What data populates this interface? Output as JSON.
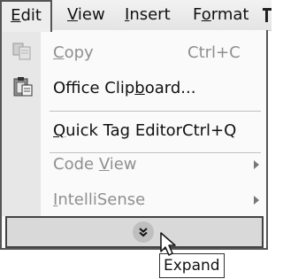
{
  "menubar": {
    "items": [
      {
        "label": "Edit",
        "key": "E",
        "rest": "dit"
      },
      {
        "label": "View",
        "key": "V",
        "rest": "iew"
      },
      {
        "label": "Insert",
        "key": "I",
        "rest": "nsert"
      },
      {
        "label": "Format",
        "pre": "F",
        "key": "o",
        "rest": "rmat"
      }
    ]
  },
  "menu": {
    "items": [
      {
        "pre": "",
        "key": "C",
        "rest": "opy",
        "shortcut": "Ctrl+C",
        "disabled": true,
        "icon": "copy-icon"
      },
      {
        "pre": "Office Clip",
        "key": "b",
        "rest": "oard...",
        "shortcut": "",
        "disabled": false,
        "icon": "clipboard-icon"
      },
      {
        "pre": "",
        "key": "Q",
        "rest": "uick Tag Editor",
        "shortcut": "Ctrl+Q",
        "disabled": false
      },
      {
        "pre": "Code ",
        "key": "V",
        "rest": "iew",
        "shortcut": "",
        "disabled": true,
        "submenu": true
      },
      {
        "pre": "",
        "key": "I",
        "rest": "ntelliSense",
        "shortcut": "",
        "disabled": true,
        "submenu": true
      }
    ],
    "expand_icon": "double-chevron-down-icon"
  },
  "tooltip": {
    "text": "Expand"
  },
  "cursor": {
    "icon": "arrow-cursor-icon"
  }
}
